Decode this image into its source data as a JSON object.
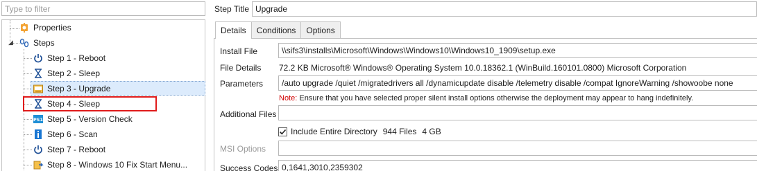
{
  "filter": {
    "placeholder": "Type to filter"
  },
  "tree": {
    "properties_label": "Properties",
    "steps_label": "Steps",
    "items": [
      {
        "label": "Step 1 - Reboot",
        "icon": "power-icon"
      },
      {
        "label": "Step 2 - Sleep",
        "icon": "hourglass-icon"
      },
      {
        "label": "Step 3 - Upgrade",
        "icon": "installer-icon",
        "selected": true
      },
      {
        "label": "Step 4 - Sleep",
        "icon": "hourglass-icon",
        "highlighted": true
      },
      {
        "label": "Step 5 - Version Check",
        "icon": "powershell-icon"
      },
      {
        "label": "Step 6 - Scan",
        "icon": "info-icon"
      },
      {
        "label": "Step 7 - Reboot",
        "icon": "power-icon"
      },
      {
        "label": "Step 8 - Windows 10 Fix Start Menu...",
        "icon": "file-copy-icon"
      }
    ]
  },
  "step_title": {
    "label": "Step Title",
    "value": "Upgrade"
  },
  "tabs": [
    "Details",
    "Conditions",
    "Options"
  ],
  "details": {
    "install_file": {
      "label": "Install File",
      "value": "\\\\sifs3\\installs\\Microsoft\\Windows\\Windows10\\Windows10_1909\\setup.exe"
    },
    "file_details": {
      "label": "File Details",
      "value": "72.2 KB Microsoft® Windows® Operating System 10.0.18362.1 (WinBuild.160101.0800) Microsoft Corporation"
    },
    "parameters": {
      "label": "Parameters",
      "value": "/auto upgrade /quiet /migratedrivers all /dynamicupdate disable /telemetry disable /compat IgnoreWarning /showoobe none"
    },
    "note": {
      "prefix": "Note:",
      "text": " Ensure that you have selected proper silent install options otherwise the deployment may appear to hang indefinitely."
    },
    "additional_files": {
      "label": "Additional Files",
      "value": ""
    },
    "include_dir": {
      "label": "Include Entire Directory",
      "files": "944 Files",
      "size": "4 GB",
      "checked": true
    },
    "msi_options": {
      "label": "MSI Options",
      "value": ""
    },
    "success_codes": {
      "label": "Success Codes",
      "value": "0,1641,3010,2359302"
    }
  },
  "colors": {
    "highlight": "#e01a1a",
    "note": "#d00000",
    "selected_bg": "#dcebfc"
  }
}
